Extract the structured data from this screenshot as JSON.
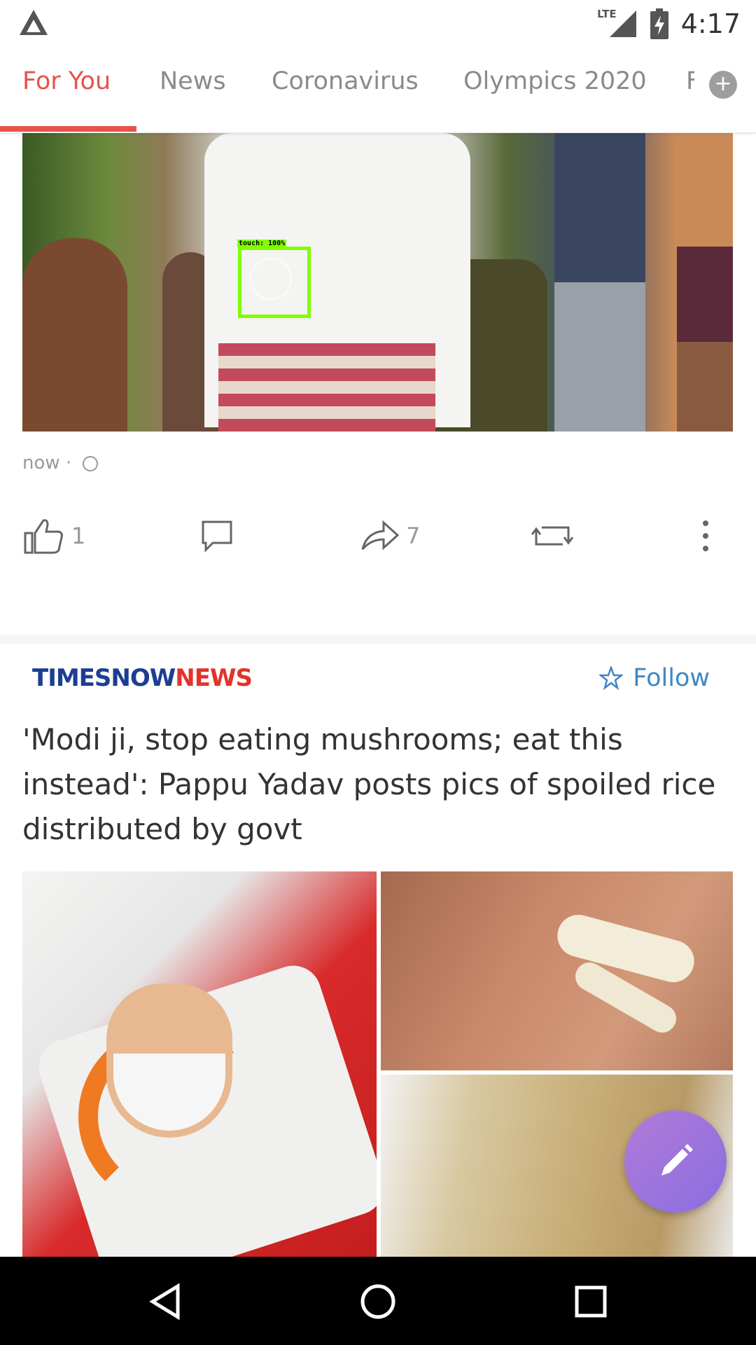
{
  "status_bar": {
    "network": "LTE",
    "time": "4:17"
  },
  "tabs": [
    {
      "label": "For You",
      "active": true
    },
    {
      "label": "News",
      "active": false
    },
    {
      "label": "Coronavirus",
      "active": false
    },
    {
      "label": "Olympics 2020",
      "active": false
    },
    {
      "label": "F",
      "active": false
    }
  ],
  "post1": {
    "timestamp": "now",
    "separator": "·",
    "like_count": "1",
    "share_count": "7",
    "touch_label": "touch: 100%"
  },
  "post2": {
    "source_part1": "TIMESNOW",
    "source_part2": "NEWS",
    "follow_label": "Follow",
    "headline": "'Modi ji, stop eating mushrooms; eat this instead': Pappu Yadav posts pics of spoiled rice distributed by govt"
  },
  "colors": {
    "accent": "#e5534b",
    "follow": "#3f86c4",
    "source_blue": "#1c3e92",
    "source_red": "#e4322b",
    "fab": "#9b74dc"
  },
  "icons": {
    "app_logo": "app-logo-icon",
    "like": "thumbs-up-icon",
    "comment": "comment-icon",
    "share": "share-arrow-icon",
    "repost": "repost-icon",
    "more": "more-vert-icon",
    "follow": "star-outline-icon",
    "fab": "pencil-icon",
    "nav_back": "back-triangle-icon",
    "nav_home": "home-circle-icon",
    "nav_recents": "recents-square-icon"
  }
}
